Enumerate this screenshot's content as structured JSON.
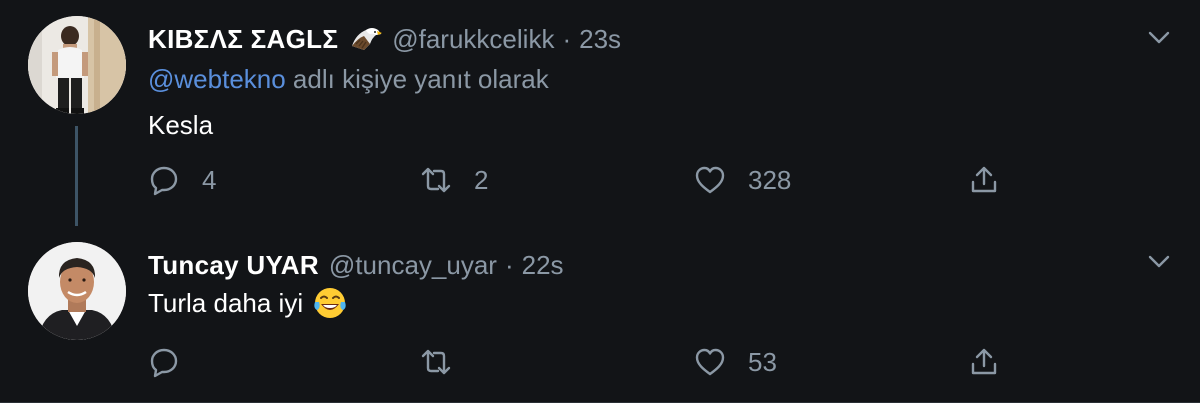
{
  "tweets": [
    {
      "display_name": "ΚΙΒΣΛΣ ΣΑGLΣ",
      "handle": "@farukkcelikk",
      "separator": "·",
      "time": "23s",
      "reply_mention": "@webtekno",
      "reply_suffix": " adlı kişiye yanıt olarak",
      "text": "Kesla",
      "replies": "4",
      "retweets": "2",
      "likes": "328"
    },
    {
      "display_name": "Tuncay UYAR",
      "handle": "@tuncay_uyar",
      "separator": "·",
      "time": "22s",
      "text": "Turla daha iyi",
      "replies": "",
      "retweets": "",
      "likes": "53"
    }
  ],
  "icons": {
    "name_emoji": "eagle-icon",
    "text_emoji": "tears-of-joy-emoji",
    "reply": "reply-icon",
    "retweet": "retweet-icon",
    "like": "heart-icon",
    "share": "share-icon",
    "more": "chevron-down-icon"
  },
  "colors": {
    "background": "#121417",
    "primary_text": "#ffffff",
    "secondary_text": "#8b98a5",
    "link": "#5a8fdc",
    "thread_line": "#3d5466"
  }
}
